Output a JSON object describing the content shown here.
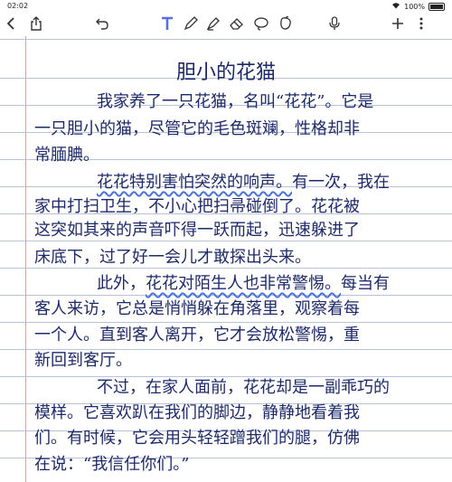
{
  "status_bar": {
    "time": "02:02",
    "battery": "100%"
  },
  "toolbar": {
    "icons": [
      "chevron-left-icon",
      "share-icon",
      "undo-icon",
      "text-tool-icon",
      "pen-icon",
      "highlighter-icon",
      "eraser-icon",
      "lasso-icon",
      "shapes-icon",
      "microphone-icon",
      "add-icon",
      "more-icon"
    ]
  },
  "note": {
    "title": "胆小的花猫",
    "lines": [
      "我家养了一只花猫，名叫“花花”。它是",
      "一只胆小的猫，尽管它的毛色斑斓，性格却非",
      "常腼腆。",
      "花花特别害怕突然的响声。有一次，我在",
      "家中打扫卫生，不小心把扫帚碰倒了。花花被",
      "这突如其来的声音吓得一跃而起，迅速躲进了",
      "床底下，过了好一会儿才敢探出头来。",
      "此外，花花对陌生人也非常警惕。每当有",
      "客人来访，它总是悄悄躲在角落里，观察着每",
      "一个人。直到客人离开，它才会放松警惕，重",
      "新回到客厅。",
      "不过，在家人面前，花花却是一副乖巧的",
      "模样。它喜欢趴在我们的脚边，静静地看着我",
      "们。有时候，它会用头轻轻蹭我们的腿，仿佛",
      "在说：“我信任你们。”"
    ]
  }
}
